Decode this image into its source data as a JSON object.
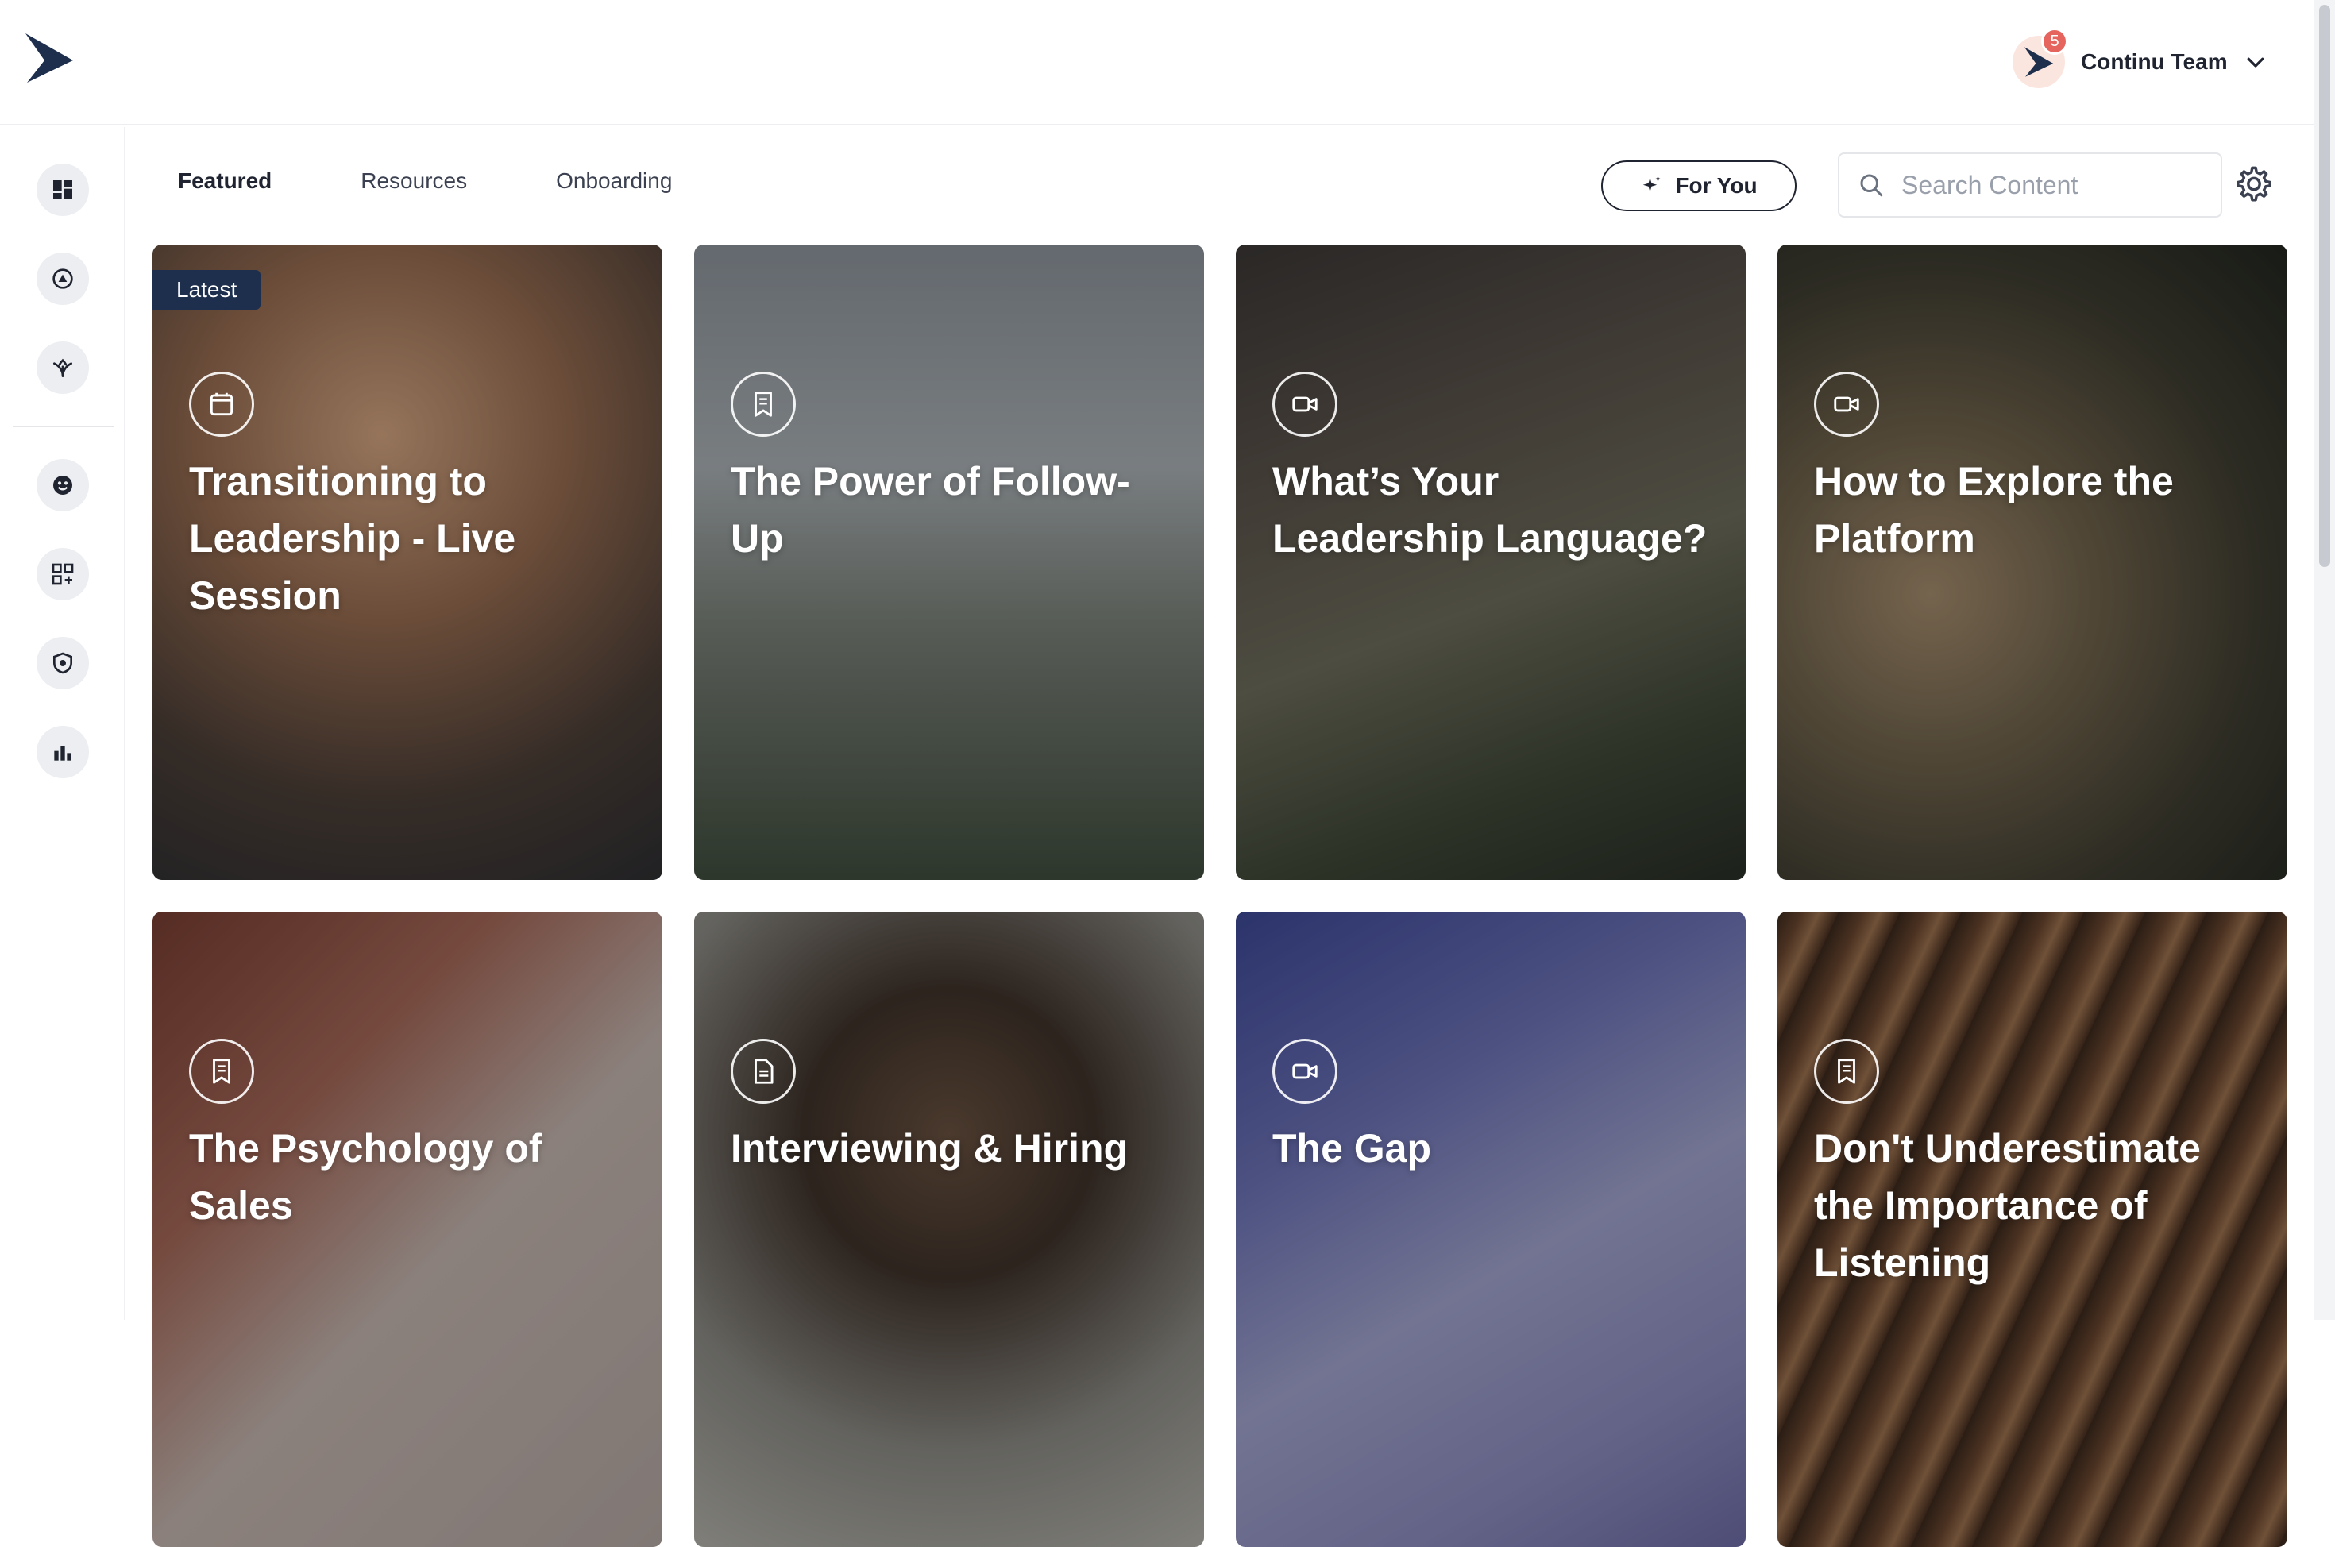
{
  "header": {
    "account": {
      "name": "Continu Team",
      "notifications": "5"
    }
  },
  "tabs": [
    {
      "label": "Featured",
      "active": true
    },
    {
      "label": "Resources",
      "active": false
    },
    {
      "label": "Onboarding",
      "active": false
    }
  ],
  "toolbar": {
    "for_you_label": "For You",
    "search_placeholder": "Search Content"
  },
  "sidebar": {
    "items": [
      {
        "icon": "dashboard-icon"
      },
      {
        "icon": "compass-icon"
      },
      {
        "icon": "leaf-icon"
      },
      {
        "icon": "smile-face-icon"
      },
      {
        "icon": "grid-add-icon"
      },
      {
        "icon": "shield-icon"
      },
      {
        "icon": "bar-chart-icon"
      }
    ]
  },
  "cards": [
    {
      "badge": "Latest",
      "type_icon": "calendar-icon",
      "title": "Transitioning to Leadership - Live Session"
    },
    {
      "type_icon": "document-icon",
      "title": "The Power of Follow-Up"
    },
    {
      "type_icon": "video-icon",
      "title": "What’s Your Leadership Language?"
    },
    {
      "type_icon": "video-icon",
      "title": "How to Explore the Platform"
    },
    {
      "type_icon": "document-icon",
      "title": "The Psychology of Sales"
    },
    {
      "type_icon": "file-icon",
      "title": "Interviewing & Hiring"
    },
    {
      "type_icon": "video-icon",
      "title": "The Gap"
    },
    {
      "type_icon": "document-icon",
      "title": "Don't Underestimate the Importance of Listening"
    }
  ],
  "colors": {
    "brand": "#1e2f4d",
    "badge": "#e5645d",
    "sidebar_button": "#eceef1"
  }
}
